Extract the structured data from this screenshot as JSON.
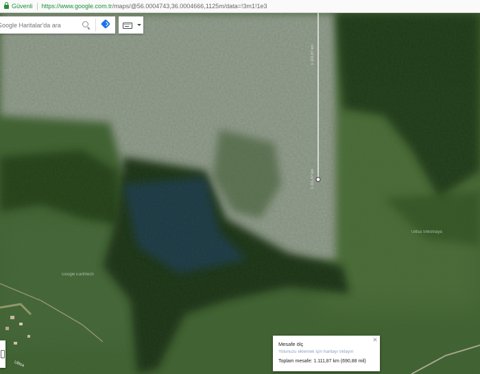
{
  "browser": {
    "secure_label": "Güvenli",
    "url_host": "https://www.google.com.tr",
    "url_rest": "/maps/@56.0004743,36.0004666,1125m/data=!3m1!1e3"
  },
  "search": {
    "placeholder": "Google Haritalar'da ara",
    "icons": [
      "search-icon",
      "directions-icon"
    ]
  },
  "toolbar": {
    "icons": [
      "keyboard-icon",
      "chevron-down-icon"
    ]
  },
  "measure_panel": {
    "title": "Mesafe ölç",
    "hint": "Yolunuzu eklemek için haritayı tıklayın",
    "total": "Toplam mesafe: 1.111,87 km (690,88 mil)",
    "close_icon": "close-icon"
  },
  "map": {
    "type": "satellite",
    "measure_line_labels": [
      "1.111,87 km",
      "1.110,87 km"
    ],
    "place_labels": [
      "Ulitsa Shkolnaya",
      "Google Earthtech"
    ],
    "road_label": "Ulitsa"
  },
  "colors": {
    "measure_line": "#ffffff",
    "direction_accent": "#1a73e8",
    "secure_green": "#1e8e3e"
  }
}
